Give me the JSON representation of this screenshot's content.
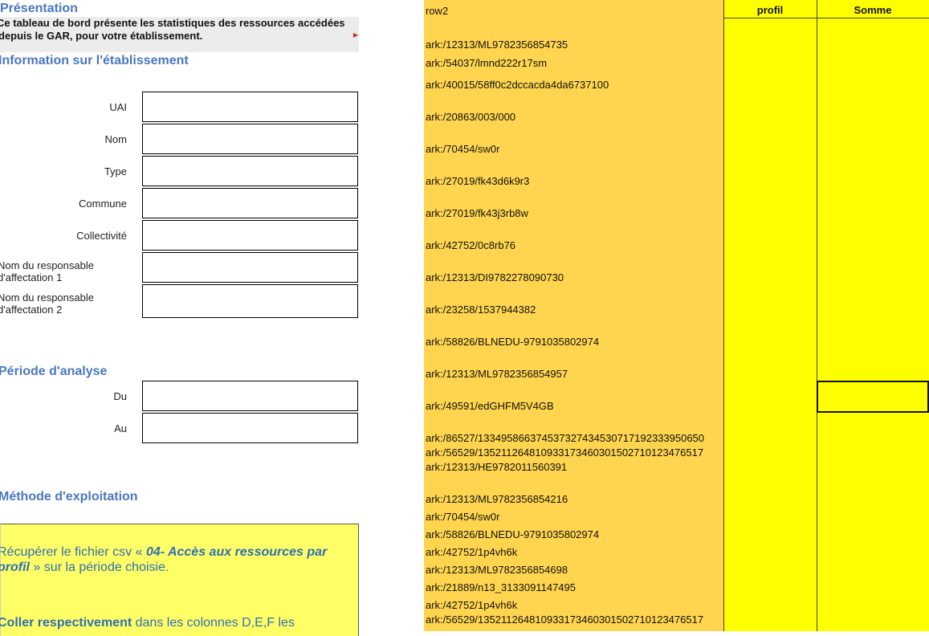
{
  "presentation": {
    "title": "Présentation",
    "text_line1": "Ce tableau de bord présente les statistiques des ressources accédées",
    "text_line2": "depuis le GAR, pour votre établissement."
  },
  "info": {
    "title": "Information sur l'établissement",
    "fields": [
      {
        "label": "UAI",
        "value": ""
      },
      {
        "label": "Nom",
        "value": ""
      },
      {
        "label": "Type",
        "value": ""
      },
      {
        "label": "Commune",
        "value": ""
      },
      {
        "label": "Collectivité",
        "value": ""
      },
      {
        "label": "Nom du responsable d'affectation 1",
        "line1": "Nom du responsable",
        "line2": "d'affectation 1",
        "value": ""
      },
      {
        "label": "Nom du responsable d'affectation 2",
        "line1": "Nom du responsable",
        "line2": "d'affectation 2",
        "value": ""
      }
    ]
  },
  "periode": {
    "title": "Période d'analyse",
    "fields": [
      {
        "label": "Du",
        "value": ""
      },
      {
        "label": "Au",
        "value": ""
      }
    ]
  },
  "methode": {
    "title": "Méthode d'exploitation",
    "step1_prefix": "Récupérer le fichier csv « ",
    "step1_emph": "04- Accès aux ressources par profil",
    "step1_suffix": " » sur la période choisie.",
    "step2_bold": "Coller respectivement",
    "step2_rest": " dans les colonnes D,E,F les"
  },
  "columns": {
    "row_header": "row2",
    "profil_header": "profil",
    "somme_header": "Somme"
  },
  "ark_rows": [
    "ark:/12313/ML9782356854735",
    "ark:/54037/lmnd222r17sm",
    "ark:/40015/58ff0c2dccacda4da6737100",
    "ark:/20863/003/000",
    "ark:/70454/sw0r",
    "ark:/27019/fk43d6k9r3",
    "ark:/27019/fk43j3rb8w",
    "ark:/42752/0c8rb76",
    "ark:/12313/DI9782278090730",
    "ark:/23258/1537944382",
    "ark:/58826/BLNEDU-9791035802974",
    "ark:/12313/ML9782356854957",
    "ark:/49591/edGHFM5V4GB",
    "ark:/86527/1334958663745373274345307171923339506​50",
    "ark:/56529/135211264810933173460301502710123476517",
    "ark:/12313/HE9782011560391",
    "ark:/12313/ML9782356854216",
    "ark:/70454/sw0r",
    "ark:/58826/BLNEDU-9791035802974",
    "ark:/42752/1p4vh6k",
    "ark:/12313/ML9782356854698",
    "ark:/21889/n13_3133091147495",
    "ark:/42752/1p4vh6k",
    "ark:/56529/135211264810933173460301502710123476517"
  ],
  "colors": {
    "heading": "#4a77c0",
    "orange_column": "#ffd54f",
    "yellow_column": "#ffff00"
  }
}
